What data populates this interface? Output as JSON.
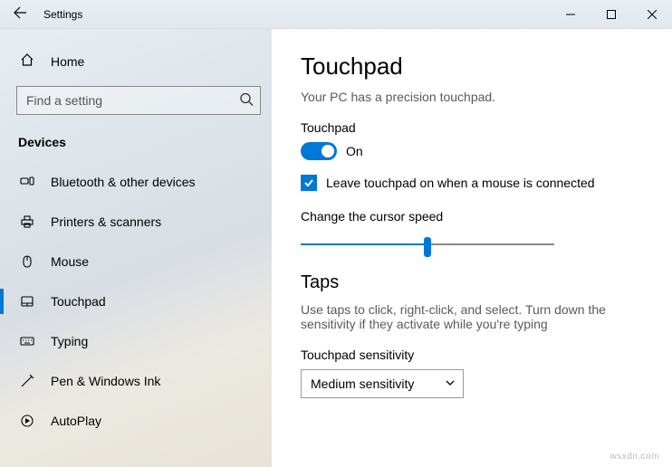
{
  "titlebar": {
    "title": "Settings"
  },
  "sidebar": {
    "home": "Home",
    "search_placeholder": "Find a setting",
    "group": "Devices",
    "items": [
      {
        "label": "Bluetooth & other devices"
      },
      {
        "label": "Printers & scanners"
      },
      {
        "label": "Mouse"
      },
      {
        "label": "Touchpad"
      },
      {
        "label": "Typing"
      },
      {
        "label": "Pen & Windows Ink"
      },
      {
        "label": "AutoPlay"
      }
    ]
  },
  "main": {
    "heading": "Touchpad",
    "subtitle": "Your PC has a precision touchpad.",
    "touchpad_label": "Touchpad",
    "toggle_state": "On",
    "leave_on_label": "Leave touchpad on when a mouse is connected",
    "cursor_speed_label": "Change the cursor speed",
    "taps_heading": "Taps",
    "taps_desc": "Use taps to click, right-click, and select. Turn down the sensitivity if they activate while you're typing",
    "sensitivity_label": "Touchpad sensitivity",
    "sensitivity_value": "Medium sensitivity"
  },
  "watermark": "wsxdn.com"
}
